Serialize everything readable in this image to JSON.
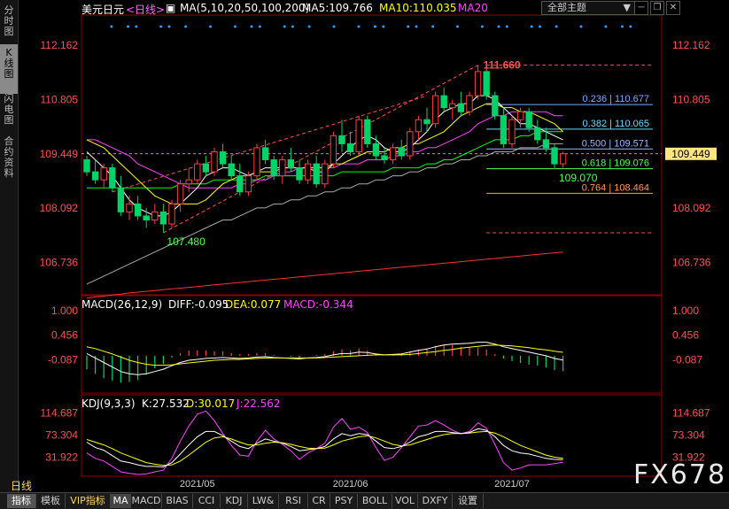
{
  "sidebar": {
    "tabs": [
      {
        "label": "分时图",
        "active": false
      },
      {
        "label": "K线图",
        "active": true
      },
      {
        "label": "闪电图",
        "active": false
      },
      {
        "label": "合约资料",
        "active": false
      }
    ]
  },
  "header": {
    "symbol": "美元日元",
    "period": "<日线>",
    "ma_label": "MA(5,10,20,50,100,200)",
    "ma5_label": "MA5:109.766",
    "ma10_label": "MA10:110.035",
    "ma20_label": "MA20",
    "theme_button": "全部主题",
    "colors": {
      "ma5": "#ffffff",
      "ma10": "#ffff00",
      "ma20": "#ff44ff",
      "ma50": "#00ff00",
      "ma100": "#aaaaaa",
      "ma200": "#ff3030"
    }
  },
  "window_buttons": [
    "minimize-icon",
    "restore-icon",
    "close-icon"
  ],
  "chart_data": {
    "type": "candlestick",
    "instrument": "美元日元",
    "period": "日线",
    "price_axis": {
      "ticks": [
        112.162,
        110.805,
        109.449,
        108.092,
        106.736
      ],
      "range": [
        106.0,
        112.8
      ]
    },
    "last_price_tag": "109.449",
    "x_labels": [
      "2021/05",
      "2021/06",
      "2021/07"
    ],
    "annotations": {
      "high": "111.660",
      "low": "107.480",
      "recent_low": "109.070"
    },
    "fibonacci": [
      {
        "label": "0.236 | 110.677",
        "price": 110.677,
        "color": "#7fa8ff"
      },
      {
        "label": "0.382 | 110.065",
        "price": 110.065,
        "color": "#6ad8ff"
      },
      {
        "label": "0.500 | 109.571",
        "price": 109.571,
        "color": "#9ab8ff"
      },
      {
        "label": "0.618 | 109.076",
        "price": 109.076,
        "color": "#55ff55"
      },
      {
        "label": "0.764 | 108.464",
        "price": 108.464,
        "color": "#ff9955"
      }
    ],
    "candles": [
      [
        109.3,
        109.4,
        108.9,
        109.0
      ],
      [
        109.0,
        109.3,
        108.7,
        108.8
      ],
      [
        108.8,
        109.2,
        108.6,
        109.1
      ],
      [
        109.1,
        109.2,
        108.5,
        108.6
      ],
      [
        108.6,
        108.9,
        107.9,
        108.0
      ],
      [
        108.0,
        108.4,
        107.8,
        108.2
      ],
      [
        108.2,
        108.4,
        107.8,
        107.9
      ],
      [
        107.9,
        108.1,
        107.6,
        107.8
      ],
      [
        107.8,
        108.2,
        107.7,
        108.0
      ],
      [
        108.0,
        108.2,
        107.48,
        107.7
      ],
      [
        107.7,
        108.3,
        107.6,
        108.2
      ],
      [
        108.2,
        108.8,
        108.0,
        108.7
      ],
      [
        108.7,
        109.1,
        108.5,
        108.8
      ],
      [
        108.8,
        109.3,
        108.7,
        109.2
      ],
      [
        109.2,
        109.4,
        108.9,
        109.0
      ],
      [
        109.0,
        109.6,
        108.9,
        109.5
      ],
      [
        109.5,
        109.7,
        109.1,
        109.2
      ],
      [
        109.2,
        109.4,
        108.8,
        108.9
      ],
      [
        108.9,
        109.2,
        108.4,
        108.5
      ],
      [
        108.5,
        109.0,
        108.4,
        108.9
      ],
      [
        108.9,
        109.7,
        108.8,
        109.6
      ],
      [
        109.6,
        109.8,
        109.2,
        109.3
      ],
      [
        109.3,
        109.4,
        108.8,
        108.9
      ],
      [
        108.9,
        109.4,
        108.7,
        109.3
      ],
      [
        109.3,
        109.6,
        109.0,
        109.1
      ],
      [
        109.1,
        109.3,
        108.7,
        108.8
      ],
      [
        108.8,
        109.3,
        108.7,
        109.2
      ],
      [
        109.2,
        109.4,
        108.6,
        108.7
      ],
      [
        108.7,
        109.3,
        108.6,
        109.2
      ],
      [
        109.2,
        110.0,
        109.1,
        109.9
      ],
      [
        109.9,
        110.3,
        109.5,
        109.7
      ],
      [
        109.7,
        110.0,
        109.4,
        109.5
      ],
      [
        109.5,
        110.4,
        109.4,
        110.3
      ],
      [
        110.3,
        110.4,
        109.6,
        109.7
      ],
      [
        109.7,
        109.9,
        109.3,
        109.4
      ],
      [
        109.4,
        109.6,
        109.2,
        109.3
      ],
      [
        109.3,
        109.7,
        109.2,
        109.6
      ],
      [
        109.6,
        109.8,
        109.3,
        109.4
      ],
      [
        109.4,
        110.1,
        109.3,
        110.0
      ],
      [
        110.0,
        110.4,
        109.8,
        110.3
      ],
      [
        110.3,
        110.6,
        110.0,
        110.2
      ],
      [
        110.2,
        111.0,
        110.1,
        110.9
      ],
      [
        110.9,
        111.1,
        110.5,
        110.6
      ],
      [
        110.6,
        110.8,
        110.3,
        110.7
      ],
      [
        110.7,
        111.0,
        110.4,
        110.5
      ],
      [
        110.5,
        111.0,
        110.4,
        110.9
      ],
      [
        110.9,
        111.66,
        110.8,
        111.5
      ],
      [
        111.5,
        111.6,
        110.8,
        110.9
      ],
      [
        110.9,
        111.0,
        110.3,
        110.4
      ],
      [
        110.4,
        110.6,
        109.6,
        109.7
      ],
      [
        109.7,
        110.4,
        109.6,
        110.3
      ],
      [
        110.3,
        110.6,
        110.1,
        110.5
      ],
      [
        110.5,
        110.6,
        110.0,
        110.1
      ],
      [
        110.1,
        110.3,
        109.7,
        109.8
      ],
      [
        109.8,
        110.1,
        109.5,
        109.6
      ],
      [
        109.6,
        109.7,
        109.07,
        109.2
      ],
      [
        109.2,
        109.5,
        109.1,
        109.45
      ]
    ],
    "ma_series": {
      "ma5": [
        109.5,
        109.3,
        109.1,
        108.9,
        108.6,
        108.3,
        108.1,
        108.0,
        107.9,
        107.9,
        108.0,
        108.2,
        108.4,
        108.6,
        108.9,
        109.0,
        109.1,
        109.1,
        109.0,
        108.9,
        109.0,
        109.1,
        109.1,
        109.1,
        109.1,
        109.1,
        109.1,
        109.0,
        109.0,
        109.2,
        109.4,
        109.6,
        109.8,
        109.9,
        109.8,
        109.6,
        109.5,
        109.5,
        109.6,
        109.8,
        110.0,
        110.3,
        110.5,
        110.6,
        110.7,
        110.7,
        110.9,
        110.9,
        110.8,
        110.6,
        110.4,
        110.2,
        110.2,
        110.1,
        110.0,
        109.9,
        109.8
      ],
      "ma10": [
        109.8,
        109.7,
        109.6,
        109.4,
        109.2,
        109.0,
        108.8,
        108.6,
        108.4,
        108.3,
        108.2,
        108.2,
        108.2,
        108.2,
        108.3,
        108.5,
        108.7,
        108.8,
        108.9,
        108.9,
        109.0,
        109.0,
        109.0,
        109.1,
        109.1,
        109.1,
        109.1,
        109.1,
        109.1,
        109.2,
        109.2,
        109.3,
        109.4,
        109.5,
        109.5,
        109.5,
        109.6,
        109.6,
        109.7,
        109.7,
        109.8,
        109.9,
        110.0,
        110.2,
        110.4,
        110.5,
        110.6,
        110.7,
        110.7,
        110.6,
        110.6,
        110.5,
        110.5,
        110.4,
        110.3,
        110.2,
        110.0
      ],
      "ma20": [
        109.8,
        109.8,
        109.7,
        109.6,
        109.5,
        109.4,
        109.2,
        109.1,
        109.0,
        108.9,
        108.8,
        108.7,
        108.6,
        108.6,
        108.6,
        108.6,
        108.6,
        108.6,
        108.7,
        108.7,
        108.8,
        108.8,
        108.9,
        109.0,
        109.0,
        109.1,
        109.1,
        109.1,
        109.1,
        109.1,
        109.2,
        109.2,
        109.2,
        109.3,
        109.3,
        109.3,
        109.4,
        109.4,
        109.5,
        109.5,
        109.6,
        109.6,
        109.7,
        109.8,
        109.9,
        110.0,
        110.2,
        110.3,
        110.4,
        110.4,
        110.5,
        110.5,
        110.5,
        110.5,
        110.5,
        110.4,
        110.4
      ],
      "ma50": [
        108.6,
        108.6,
        108.6,
        108.6,
        108.6,
        108.6,
        108.6,
        108.6,
        108.6,
        108.6,
        108.6,
        108.7,
        108.7,
        108.7,
        108.7,
        108.8,
        108.8,
        108.8,
        108.8,
        108.8,
        108.8,
        108.9,
        108.9,
        108.9,
        108.9,
        108.9,
        108.9,
        108.9,
        108.9,
        108.9,
        109.0,
        109.0,
        109.0,
        109.0,
        109.0,
        109.0,
        109.1,
        109.1,
        109.1,
        109.1,
        109.2,
        109.2,
        109.3,
        109.3,
        109.4,
        109.5,
        109.6,
        109.7,
        109.8,
        109.8,
        109.8,
        109.9,
        109.9,
        110.0,
        110.0,
        110.0,
        110.0
      ],
      "ma100": [
        106.2,
        106.3,
        106.4,
        106.5,
        106.6,
        106.7,
        106.8,
        106.9,
        107.0,
        107.1,
        107.2,
        107.3,
        107.4,
        107.5,
        107.6,
        107.7,
        107.8,
        107.8,
        107.9,
        108.0,
        108.1,
        108.1,
        108.2,
        108.2,
        108.3,
        108.3,
        108.4,
        108.4,
        108.5,
        108.5,
        108.6,
        108.6,
        108.7,
        108.7,
        108.8,
        108.8,
        108.9,
        108.9,
        109.0,
        109.0,
        109.1,
        109.1,
        109.2,
        109.2,
        109.3,
        109.3,
        109.4,
        109.4,
        109.5,
        109.5,
        109.5,
        109.6,
        109.6,
        109.6,
        109.7,
        109.7,
        109.7
      ],
      "ma200": [
        105.85,
        105.88,
        105.9,
        105.93,
        105.95,
        105.98,
        106.0,
        106.02,
        106.04,
        106.06,
        106.08,
        106.1,
        106.12,
        106.14,
        106.16,
        106.18,
        106.2,
        106.22,
        106.24,
        106.26,
        106.28,
        106.3,
        106.32,
        106.34,
        106.36,
        106.38,
        106.4,
        106.42,
        106.44,
        106.46,
        106.48,
        106.5,
        106.52,
        106.54,
        106.56,
        106.58,
        106.6,
        106.62,
        106.64,
        106.66,
        106.68,
        106.7,
        106.72,
        106.74,
        106.76,
        106.78,
        106.8,
        106.82,
        106.84,
        106.86,
        106.88,
        106.9,
        106.92,
        106.94,
        106.96,
        106.98,
        107.0
      ]
    },
    "macd": {
      "label": "MACD(26,12,9)",
      "diff_label": "DIFF:-0.095",
      "dea_label": "DEA:0.077",
      "macd_label": "MACD:-0.344",
      "ticks": [
        1.0,
        0.456,
        -0.087
      ],
      "tick_labels": [
        "1.000",
        "0.456",
        "-0.087"
      ],
      "range": [
        -0.75,
        1.1
      ],
      "diff": [
        0.05,
        -0.05,
        -0.15,
        -0.25,
        -0.35,
        -0.4,
        -0.42,
        -0.4,
        -0.35,
        -0.3,
        -0.22,
        -0.15,
        -0.1,
        -0.08,
        -0.06,
        -0.05,
        -0.04,
        -0.05,
        -0.06,
        -0.05,
        -0.03,
        -0.02,
        -0.04,
        -0.05,
        -0.06,
        -0.07,
        -0.05,
        -0.04,
        -0.02,
        0.02,
        0.05,
        0.05,
        0.08,
        0.07,
        0.04,
        0.02,
        0.03,
        0.04,
        0.08,
        0.12,
        0.15,
        0.2,
        0.24,
        0.26,
        0.27,
        0.28,
        0.3,
        0.3,
        0.26,
        0.2,
        0.16,
        0.12,
        0.08,
        0.04,
        0.0,
        -0.06,
        -0.095
      ],
      "dea": [
        0.2,
        0.16,
        0.1,
        0.04,
        -0.03,
        -0.1,
        -0.15,
        -0.19,
        -0.21,
        -0.21,
        -0.2,
        -0.18,
        -0.16,
        -0.14,
        -0.12,
        -0.1,
        -0.09,
        -0.08,
        -0.08,
        -0.07,
        -0.06,
        -0.05,
        -0.05,
        -0.05,
        -0.05,
        -0.05,
        -0.05,
        -0.05,
        -0.04,
        -0.03,
        -0.02,
        -0.01,
        0.0,
        0.01,
        0.02,
        0.02,
        0.02,
        0.02,
        0.03,
        0.05,
        0.07,
        0.09,
        0.12,
        0.14,
        0.17,
        0.19,
        0.21,
        0.23,
        0.24,
        0.23,
        0.22,
        0.2,
        0.18,
        0.15,
        0.13,
        0.1,
        0.077
      ],
      "hist": [
        -0.3,
        -0.4,
        -0.5,
        -0.55,
        -0.6,
        -0.58,
        -0.54,
        -0.42,
        -0.28,
        -0.18,
        -0.04,
        0.06,
        0.12,
        0.12,
        0.12,
        0.1,
        0.1,
        0.06,
        0.04,
        0.04,
        0.06,
        0.06,
        0.02,
        0.0,
        -0.02,
        -0.04,
        0.0,
        0.02,
        0.04,
        0.1,
        0.14,
        0.12,
        0.16,
        0.12,
        0.04,
        0.0,
        0.02,
        0.04,
        0.1,
        0.14,
        0.16,
        0.22,
        0.24,
        0.24,
        0.2,
        0.18,
        0.18,
        0.14,
        0.04,
        -0.06,
        -0.12,
        -0.16,
        -0.2,
        -0.22,
        -0.26,
        -0.32,
        -0.344
      ]
    },
    "kdj": {
      "label": "KDJ(9,3,3)",
      "k_label": "K:27.532",
      "d_label": "D:30.017",
      "j_label": "J:22.562",
      "ticks": [
        114.687,
        73.304,
        31.922
      ],
      "tick_labels": [
        "114.687",
        "73.304",
        "31.922"
      ],
      "range": [
        0,
        125
      ],
      "k": [
        60,
        50,
        45,
        35,
        25,
        22,
        18,
        15,
        15,
        14,
        22,
        38,
        55,
        70,
        80,
        80,
        72,
        62,
        52,
        48,
        58,
        66,
        62,
        58,
        52,
        44,
        46,
        48,
        52,
        66,
        76,
        72,
        76,
        74,
        62,
        50,
        48,
        52,
        60,
        70,
        74,
        80,
        80,
        78,
        76,
        78,
        85,
        82,
        70,
        54,
        44,
        40,
        38,
        34,
        30,
        28,
        27.5
      ],
      "d": [
        65,
        60,
        55,
        48,
        40,
        34,
        28,
        22,
        19,
        17,
        18,
        25,
        36,
        48,
        60,
        68,
        70,
        66,
        60,
        55,
        55,
        58,
        60,
        59,
        56,
        52,
        49,
        48,
        49,
        55,
        62,
        66,
        70,
        72,
        68,
        62,
        56,
        53,
        55,
        60,
        65,
        70,
        74,
        76,
        76,
        77,
        79,
        80,
        77,
        70,
        62,
        54,
        48,
        42,
        36,
        32,
        30.0
      ],
      "j": [
        40,
        30,
        25,
        15,
        5,
        2,
        0,
        1,
        5,
        8,
        30,
        62,
        90,
        112,
        118,
        100,
        76,
        54,
        36,
        34,
        62,
        82,
        66,
        56,
        44,
        28,
        40,
        48,
        58,
        88,
        104,
        84,
        88,
        78,
        50,
        26,
        32,
        50,
        70,
        90,
        92,
        100,
        92,
        82,
        76,
        80,
        96,
        86,
        56,
        22,
        8,
        12,
        18,
        18,
        18,
        20,
        22.5
      ]
    }
  },
  "bottom_tabs": [
    {
      "label": "指标",
      "active": true
    },
    {
      "label": "模板",
      "active": false
    },
    {
      "label": "VIP指标",
      "active": false,
      "vip": true
    },
    {
      "label": "MA",
      "active": true
    },
    {
      "label": "MACD",
      "active": false
    },
    {
      "label": "BIAS",
      "active": false
    },
    {
      "label": "CCI",
      "active": false
    },
    {
      "label": "KDJ",
      "active": false
    },
    {
      "label": "LW&",
      "active": false
    },
    {
      "label": "RSI",
      "active": false
    },
    {
      "label": "CR",
      "active": false
    },
    {
      "label": "PSY",
      "active": false
    },
    {
      "label": "BOLL",
      "active": false
    },
    {
      "label": "VOL",
      "active": false
    },
    {
      "label": "DXFY",
      "active": false
    },
    {
      "label": "设置",
      "active": false
    }
  ],
  "period_label": "日线",
  "watermark": "FX678"
}
